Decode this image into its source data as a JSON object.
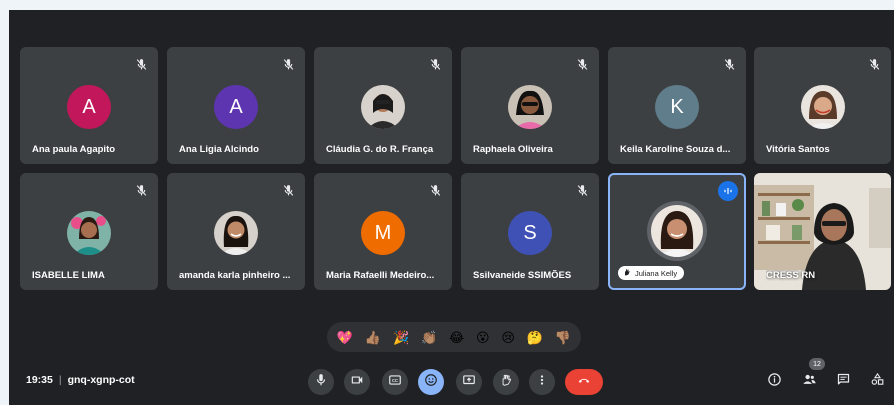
{
  "participants": [
    {
      "name": "Ana paula Agapito",
      "initial": "A",
      "color": "#c2185b",
      "muted": true
    },
    {
      "name": "Ana Ligia Alcindo",
      "initial": "A",
      "color": "#5e35b1",
      "muted": true
    },
    {
      "name": "Cláudia G. do R. França",
      "initial": "",
      "muted": true
    },
    {
      "name": "Raphaela Oliveira",
      "initial": "",
      "muted": true
    },
    {
      "name": "Keila Karoline Souza d...",
      "initial": "K",
      "color": "#607d8b",
      "muted": true
    },
    {
      "name": "Vitória Santos",
      "initial": "",
      "muted": true
    },
    {
      "name": "ISABELLE LIMA",
      "initial": "",
      "muted": true
    },
    {
      "name": "amanda karla pinheiro ...",
      "initial": "",
      "muted": true
    },
    {
      "name": "Maria Rafaelli Medeiro...",
      "initial": "M",
      "color": "#ef6c00",
      "muted": true
    },
    {
      "name": "Ssilvaneide SSIMÕES",
      "initial": "S",
      "color": "#3f51b5",
      "muted": true
    },
    {
      "name": "Juliana Kelly",
      "initial": "",
      "muted": false,
      "speaking": true
    },
    {
      "name": "CRESS RN",
      "initial": "",
      "muted": false,
      "video": true
    }
  ],
  "reactions": [
    "💖",
    "👍🏽",
    "🎉",
    "👏🏽",
    "😂",
    "😮",
    "😢",
    "🤔",
    "👎🏽"
  ],
  "meeting": {
    "time": "19:35",
    "separator": "|",
    "code": "gnq-xgnp-cot"
  },
  "people_count": "12",
  "controls": [
    "mic-off-icon",
    "camera-off-icon",
    "captions-icon",
    "emoji-icon",
    "present-icon",
    "raise-hand-icon",
    "more-options-icon",
    "hang-up-icon"
  ],
  "right_controls": [
    "info-icon",
    "people-icon",
    "chat-icon",
    "activities-icon"
  ]
}
